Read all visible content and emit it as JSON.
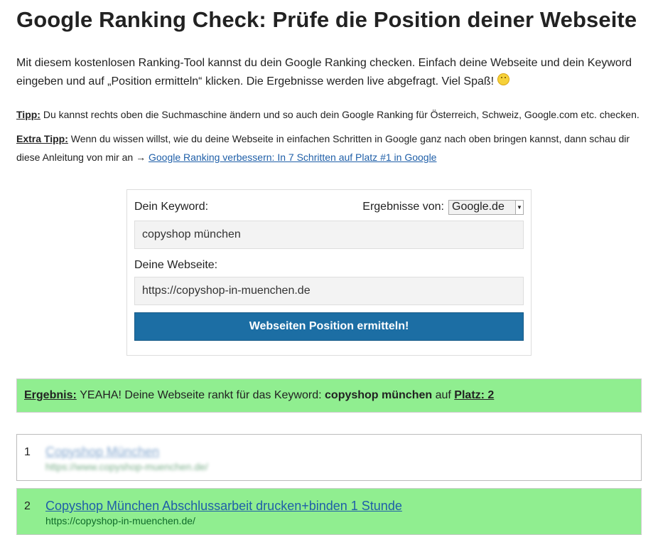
{
  "title": "Google Ranking Check: Prüfe die Position deiner Webseite",
  "intro": "Mit diesem kostenlosen Ranking-Tool kannst du dein Google Ranking checken. Einfach deine Webseite und dein Keyword eingeben und auf „Position ermitteln“ klicken. Die Ergebnisse werden live abgefragt. Viel Spaß!",
  "tip": {
    "label": "Tipp:",
    "text": "Du kannst rechts oben die Suchmaschine ändern und so auch dein Google Ranking für Österreich, Schweiz, Google.com etc. checken."
  },
  "extra_tip": {
    "label": "Extra Tipp:",
    "text": "Wenn du wissen willst, wie du deine Webseite in einfachen Schritten in Google ganz nach oben bringen kannst, dann schau dir diese Anleitung von mir an →",
    "link_text": "Google Ranking verbessern: In 7 Schritten auf Platz #1 in Google"
  },
  "form": {
    "keyword_label": "Dein Keyword:",
    "results_from_label": "Ergebnisse von:",
    "engine_selected": "Google.de",
    "keyword_value": "copyshop münchen",
    "website_label": "Deine Webseite:",
    "website_value": "https://copyshop-in-muenchen.de",
    "submit_label": "Webseiten Position ermitteln!"
  },
  "result": {
    "label": "Ergebnis:",
    "prefix": "YEAHA! Deine Webseite rankt für das Keyword:",
    "keyword": "copyshop münchen",
    "middle": "auf",
    "rank": "Platz: 2"
  },
  "results_list": [
    {
      "rank": "1",
      "title": "Copyshop München",
      "url": "https://www.copyshop-muenchen.de/"
    },
    {
      "rank": "2",
      "title": "Copyshop München Abschlussarbeit drucken+binden 1 Stunde",
      "url": "https://copyshop-in-muenchen.de/"
    }
  ]
}
